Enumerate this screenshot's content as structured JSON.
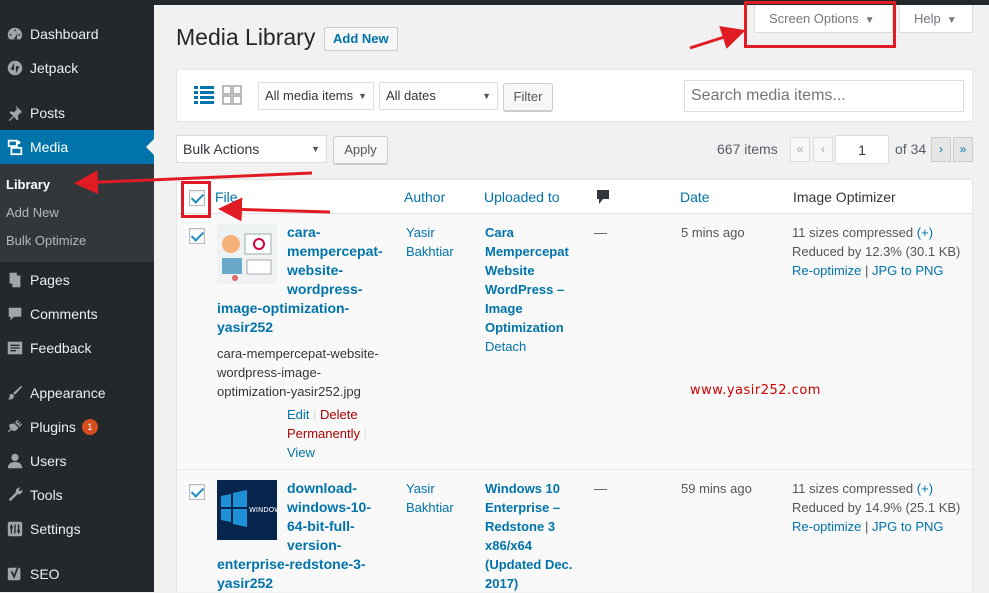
{
  "sidebar": {
    "items": [
      {
        "label": "Dashboard",
        "icon": "dashboard-icon"
      },
      {
        "label": "Jetpack",
        "icon": "jetpack-icon"
      },
      {
        "label": "Posts",
        "icon": "pin-icon"
      },
      {
        "label": "Media",
        "icon": "media-icon"
      },
      {
        "label": "Pages",
        "icon": "pages-icon"
      },
      {
        "label": "Comments",
        "icon": "comment-icon"
      },
      {
        "label": "Feedback",
        "icon": "feedback-icon"
      },
      {
        "label": "Appearance",
        "icon": "brush-icon"
      },
      {
        "label": "Plugins",
        "icon": "plug-icon",
        "badge": "1"
      },
      {
        "label": "Users",
        "icon": "user-icon"
      },
      {
        "label": "Tools",
        "icon": "wrench-icon"
      },
      {
        "label": "Settings",
        "icon": "settings-icon"
      },
      {
        "label": "SEO",
        "icon": "yoast-icon"
      }
    ],
    "submenu": [
      "Library",
      "Add New",
      "Bulk Optimize"
    ]
  },
  "header": {
    "title": "Media Library",
    "add_new": "Add New",
    "screen_options": "Screen Options",
    "help": "Help"
  },
  "toolbar": {
    "filter_type": "All media items",
    "filter_date": "All dates",
    "filter_button": "Filter",
    "search_placeholder": "Search media items..."
  },
  "tablenav": {
    "bulk_actions": "Bulk Actions",
    "apply": "Apply",
    "items_count": "667 items",
    "first": "«",
    "prev": "‹",
    "current_page": "1",
    "of_pages": "of 34",
    "next": "›",
    "last": "»"
  },
  "columns": {
    "file": "File",
    "author": "Author",
    "uploaded_to": "Uploaded to",
    "date": "Date",
    "image_optimizer": "Image Optimizer"
  },
  "rows": [
    {
      "title_lines": [
        "cara-",
        "mempercepat-",
        "website-",
        "wordpress-",
        "image-optimization-",
        "yasir252"
      ],
      "filename_lines": [
        "cara-mempercepat-website-",
        "wordpress-image-",
        "optimization-yasir252.jpg"
      ],
      "author_lines": [
        "Yasir",
        "Bakhtiar"
      ],
      "uploaded_lines": [
        "Cara",
        "Mempercepat",
        "Website",
        "WordPress –",
        "Image",
        "Optimization"
      ],
      "detach": "Detach",
      "comments": "—",
      "date": "5 mins ago",
      "opt_sizes": "11 sizes compressed",
      "opt_plus": "(+)",
      "opt_reduced": "Reduced by 12.3% (30.1 KB)",
      "reoptimize": "Re-optimize",
      "sep": "|",
      "jpg_to_png": "JPG to PNG",
      "action_edit": "Edit",
      "action_delete": "Delete",
      "action_permanently": "Permanently",
      "action_view": "View"
    },
    {
      "title_lines": [
        "download-",
        "windows-10-",
        "64-bit-full-",
        "version-",
        "enterprise-redstone-3-",
        "yasir252"
      ],
      "author_lines": [
        "Yasir",
        "Bakhtiar"
      ],
      "uploaded_lines": [
        "Windows 10",
        "Enterprise –",
        "Redstone 3",
        "x86/x64",
        "(Updated Dec.",
        "2017)"
      ],
      "comments": "—",
      "date": "59 mins ago",
      "opt_sizes": "11 sizes compressed",
      "opt_plus": "(+)",
      "opt_reduced": "Reduced by 14.9% (25.1 KB)",
      "reoptimize": "Re-optimize",
      "sep": "|",
      "jpg_to_png": "JPG to PNG",
      "thumb_text": "WINDOWS"
    }
  ],
  "watermark": "www.yasir252.com",
  "colors": {
    "accent": "#0073aa",
    "sidebar": "#23282d",
    "annotation": "#e01b24"
  }
}
